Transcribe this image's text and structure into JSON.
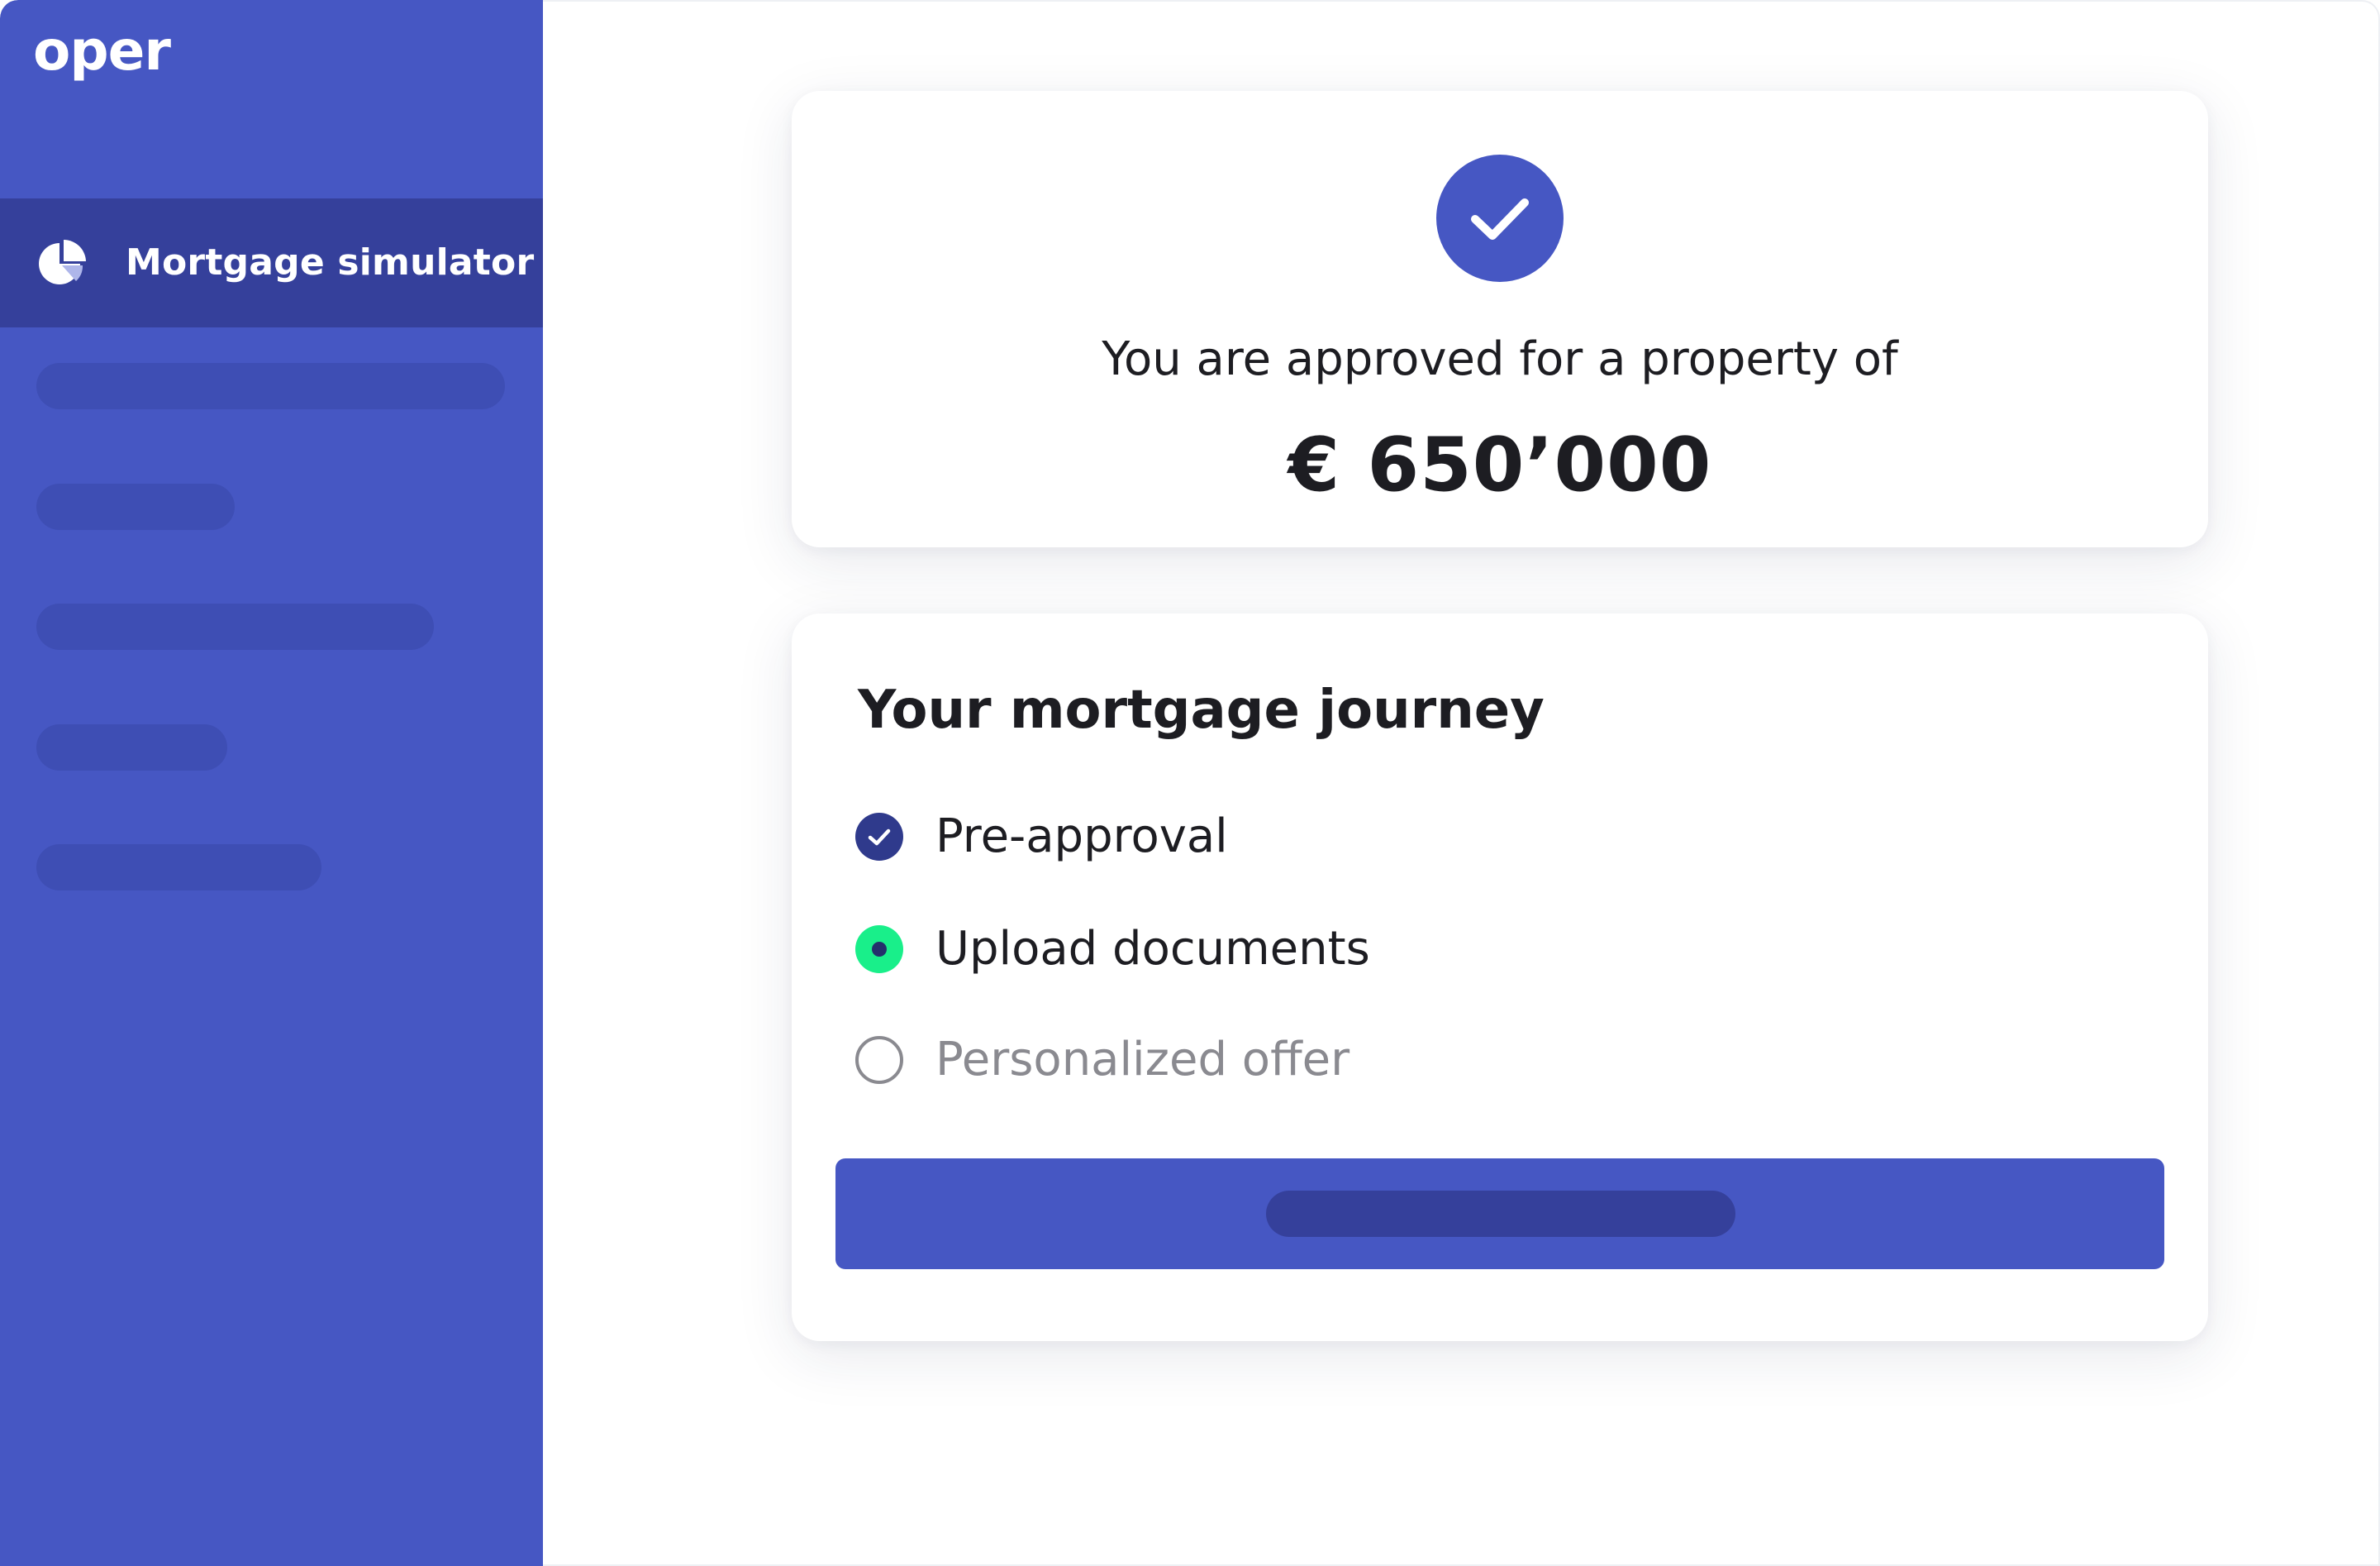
{
  "app": {
    "brand": "oper",
    "colors": {
      "primary": "#4657c3",
      "sidebar_active": "#35409b",
      "skeleton": "#3e4eb4",
      "step_done": "#2f3a8c",
      "step_current": "#19ef8a",
      "step_pending": "#8a8a90"
    }
  },
  "sidebar": {
    "active_item": {
      "label": "Mortgage simulator",
      "icon": "pie-chart-icon"
    },
    "placeholder_items": 5
  },
  "approval": {
    "icon": "check-icon",
    "message": "You are approved for a property of",
    "amount": "€ 650’000"
  },
  "journey": {
    "title": "Your mortgage journey",
    "steps": [
      {
        "label": "Pre-approval",
        "status": "completed",
        "icon": "check-circle-icon"
      },
      {
        "label": "Upload documents",
        "status": "current",
        "icon": "current-step-icon"
      },
      {
        "label": "Personalized offer",
        "status": "pending",
        "icon": "empty-circle-icon"
      }
    ]
  }
}
